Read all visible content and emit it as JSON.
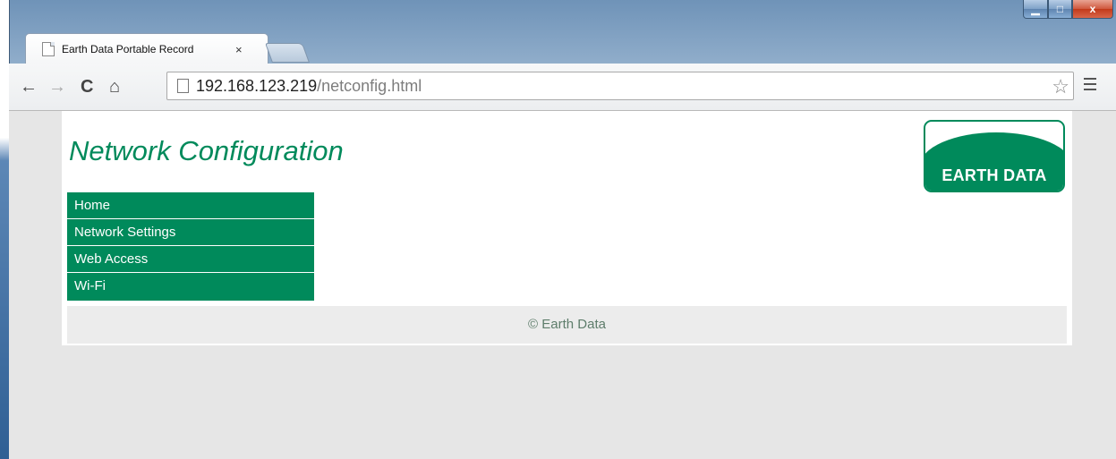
{
  "browser": {
    "tab_title": "Earth Data Portable Record",
    "tab_close": "×",
    "url_host": "192.168.123.219",
    "url_path": "/netconfig.html",
    "nav": {
      "back": "←",
      "forward": "→",
      "reload": "C",
      "home": "⌂"
    },
    "star": "☆"
  },
  "window_controls": {
    "minimize": "▁",
    "maximize": "□",
    "close": "x"
  },
  "page": {
    "title": "Network Configuration",
    "logo_text": "EARTH DATA",
    "menu": [
      {
        "label": "Home"
      },
      {
        "label": "Network Settings"
      },
      {
        "label": "Web Access"
      },
      {
        "label": "Wi-Fi"
      }
    ],
    "footer": "© Earth Data"
  },
  "colors": {
    "brand_green": "#008a5b",
    "background_gray": "#e6e6e6",
    "footer_gray": "#ececec"
  },
  "icons": {
    "tab": "document-icon",
    "omnibox": "page-icon",
    "bookmark": "star-icon",
    "menu": "hamburger-menu-icon"
  }
}
